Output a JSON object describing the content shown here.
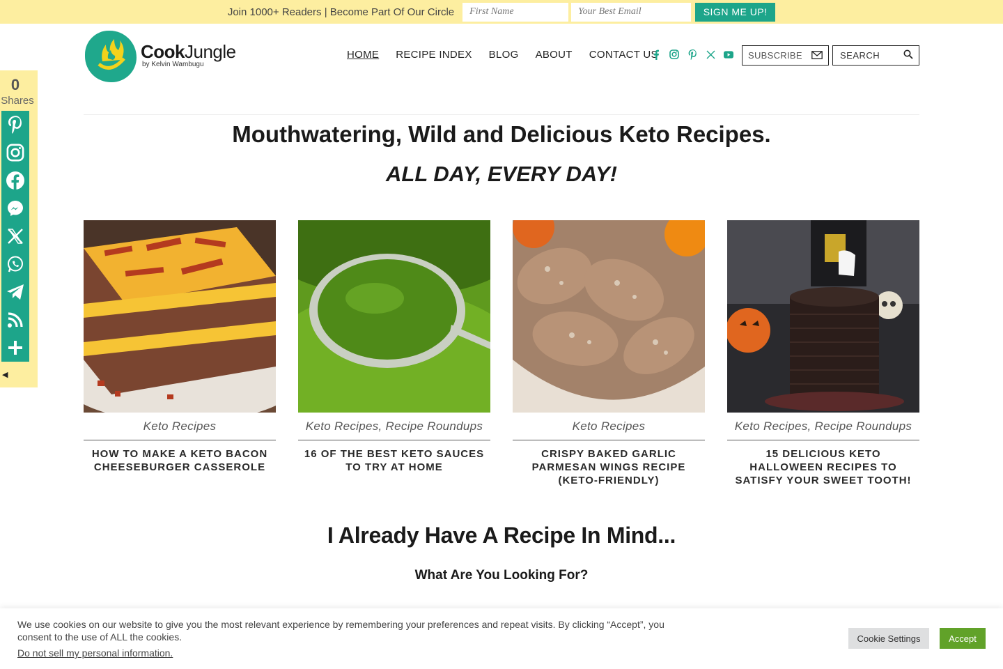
{
  "optin": {
    "message": "Join 1000+ Readers | Become Part Of Our Circle",
    "first_name_placeholder": "First Name",
    "email_placeholder": "Your Best Email",
    "button": "SIGN ME UP!"
  },
  "logo": {
    "name_bold": "Cook",
    "name_rest": "Jungle",
    "by": "by Kelvin Wambugu"
  },
  "nav": [
    "HOME",
    "RECIPE INDEX",
    "BLOG",
    "ABOUT",
    "CONTACT US"
  ],
  "social_icons": [
    "facebook-icon",
    "instagram-icon",
    "pinterest-icon",
    "x-icon",
    "youtube-icon"
  ],
  "subscribe": "SUBSCRIBE",
  "search": "SEARCH",
  "hero": {
    "title": "Mouthwatering, Wild and Delicious Keto Recipes.",
    "subtitle": "ALL DAY, EVERY DAY!"
  },
  "share": {
    "count": "0",
    "label": "Shares"
  },
  "cards": [
    {
      "category": "Keto Recipes",
      "title": "How to Make a Keto Bacon Cheeseburger Casserole"
    },
    {
      "category": "Keto Recipes, Recipe Roundups",
      "title": "16 of the Best Keto Sauces to Try at Home"
    },
    {
      "category": "Keto Recipes",
      "title": "Crispy Baked Garlic Parmesan Wings Recipe (Keto-Friendly)"
    },
    {
      "category": "Keto Recipes, Recipe Roundups",
      "title": "15 Delicious Keto Halloween Recipes to Satisfy Your Sweet Tooth!"
    }
  ],
  "recipe_section": {
    "heading": "I Already Have A Recipe In Mind...",
    "subheading": "What Are You Looking For?"
  },
  "cookie": {
    "text": "We use cookies on our website to give you the most relevant experience by remembering your preferences and repeat visits. By clicking “Accept”, you consent to the use of ALL the cookies.",
    "dns": "Do not sell my personal information.",
    "settings": "Cookie Settings",
    "accept": "Accept"
  }
}
